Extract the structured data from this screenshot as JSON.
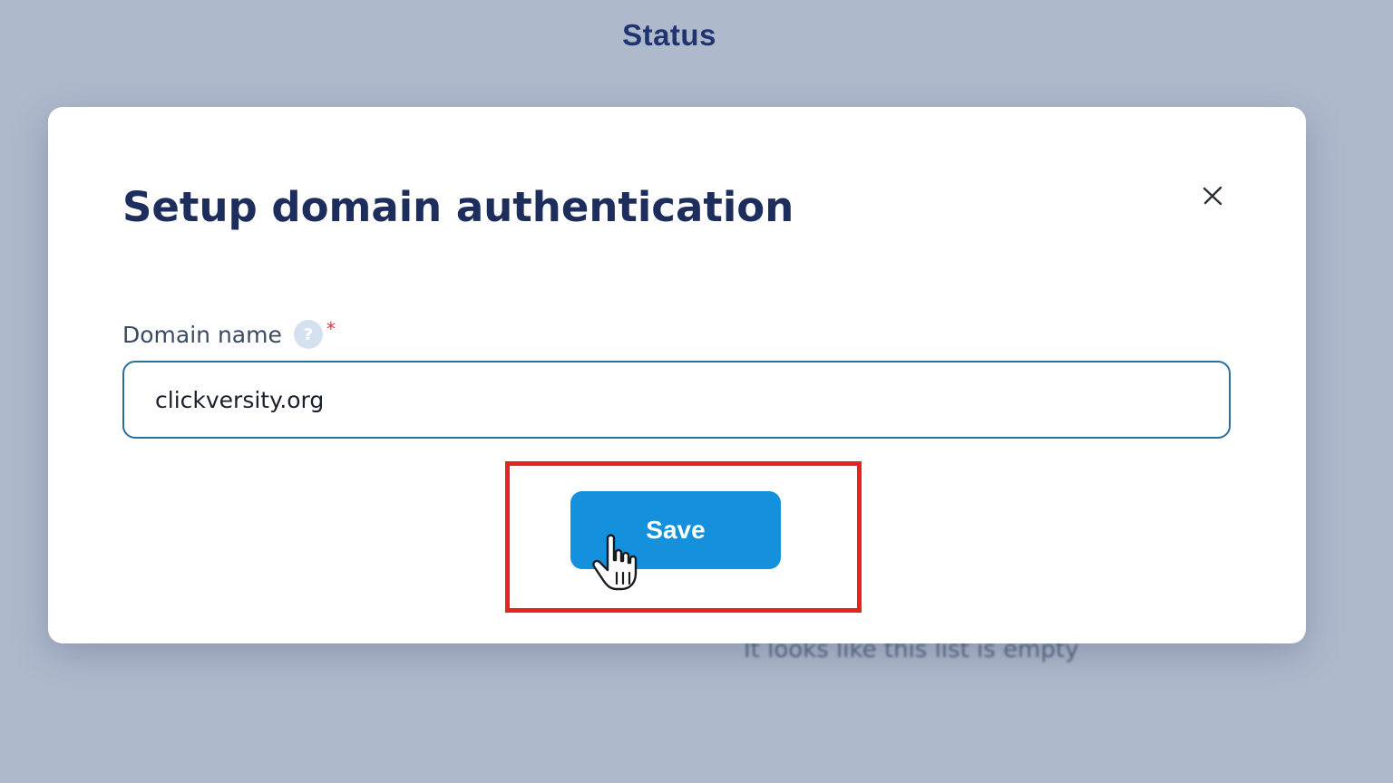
{
  "background": {
    "status_heading": "Status",
    "empty_message": "It looks like this list is empty"
  },
  "modal": {
    "title": "Setup domain authentication",
    "close_icon": "close-icon",
    "field": {
      "label": "Domain name",
      "help_icon": "help-icon",
      "help_glyph": "?",
      "required_mark": "*",
      "value": "clickversity.org"
    },
    "save_label": "Save"
  },
  "cursor_icon": "hand-pointer-icon",
  "colors": {
    "accent": "#1590dd",
    "title": "#1d2d5c",
    "highlight": "#e8231c",
    "background": "#aeb9cc"
  }
}
